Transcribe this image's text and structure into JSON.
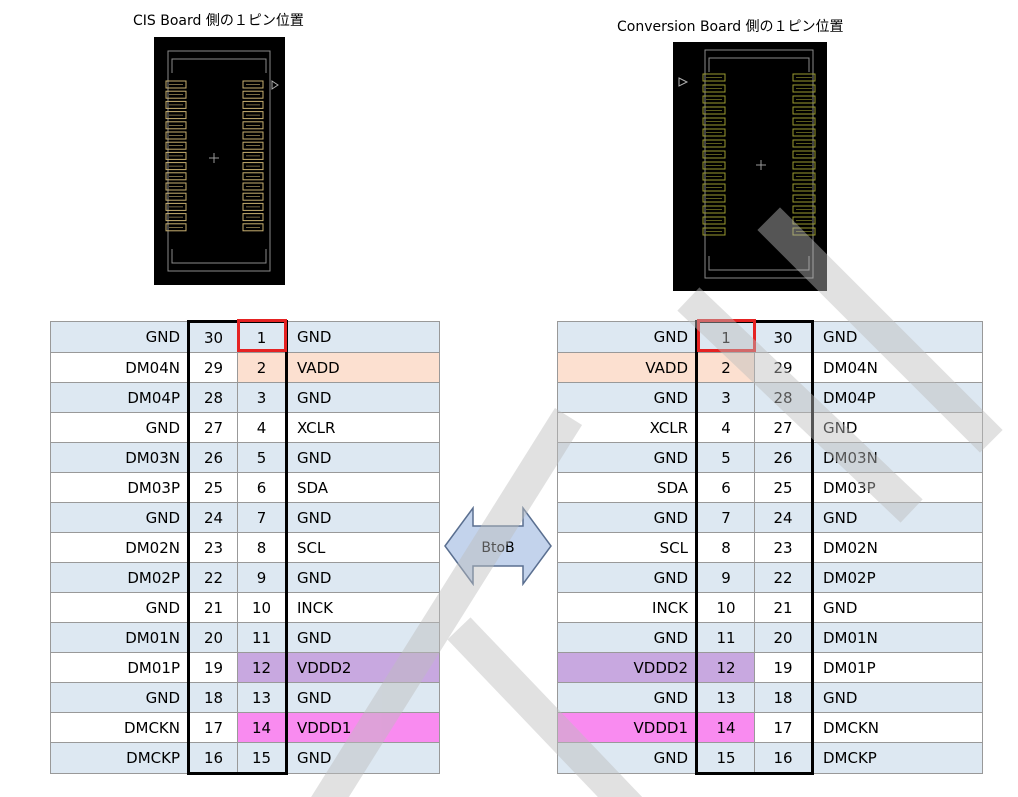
{
  "left": {
    "caption": "CIS  Board 側の１ピン位置",
    "rows": [
      {
        "name": "GND",
        "outer": "30",
        "inner": "1",
        "sig": "GND"
      },
      {
        "name": "DM04N",
        "outer": "29",
        "inner": "2",
        "sig": "VADD"
      },
      {
        "name": "DM04P",
        "outer": "28",
        "inner": "3",
        "sig": "GND"
      },
      {
        "name": "GND",
        "outer": "27",
        "inner": "4",
        "sig": "XCLR"
      },
      {
        "name": "DM03N",
        "outer": "26",
        "inner": "5",
        "sig": "GND"
      },
      {
        "name": "DM03P",
        "outer": "25",
        "inner": "6",
        "sig": "SDA"
      },
      {
        "name": "GND",
        "outer": "24",
        "inner": "7",
        "sig": "GND"
      },
      {
        "name": "DM02N",
        "outer": "23",
        "inner": "8",
        "sig": "SCL"
      },
      {
        "name": "DM02P",
        "outer": "22",
        "inner": "9",
        "sig": "GND"
      },
      {
        "name": "GND",
        "outer": "21",
        "inner": "10",
        "sig": "INCK"
      },
      {
        "name": "DM01N",
        "outer": "20",
        "inner": "11",
        "sig": "GND"
      },
      {
        "name": "DM01P",
        "outer": "19",
        "inner": "12",
        "sig": "VDDD2"
      },
      {
        "name": "GND",
        "outer": "18",
        "inner": "13",
        "sig": "GND"
      },
      {
        "name": "DMCKN",
        "outer": "17",
        "inner": "14",
        "sig": "VDDD1"
      },
      {
        "name": "DMCKP",
        "outer": "16",
        "inner": "15",
        "sig": "GND"
      }
    ]
  },
  "right": {
    "caption": "Conversion Board 側の１ピン位置",
    "rows": [
      {
        "sig": "GND",
        "inner": "1",
        "outer": "30",
        "name": "GND"
      },
      {
        "sig": "VADD",
        "inner": "2",
        "outer": "29",
        "name": "DM04N"
      },
      {
        "sig": "GND",
        "inner": "3",
        "outer": "28",
        "name": "DM04P"
      },
      {
        "sig": "XCLR",
        "inner": "4",
        "outer": "27",
        "name": "GND"
      },
      {
        "sig": "GND",
        "inner": "5",
        "outer": "26",
        "name": "DM03N"
      },
      {
        "sig": "SDA",
        "inner": "6",
        "outer": "25",
        "name": "DM03P"
      },
      {
        "sig": "GND",
        "inner": "7",
        "outer": "24",
        "name": "GND"
      },
      {
        "sig": "SCL",
        "inner": "8",
        "outer": "23",
        "name": "DM02N"
      },
      {
        "sig": "GND",
        "inner": "9",
        "outer": "22",
        "name": "DM02P"
      },
      {
        "sig": "INCK",
        "inner": "10",
        "outer": "21",
        "name": "GND"
      },
      {
        "sig": "GND",
        "inner": "11",
        "outer": "20",
        "name": "DM01N"
      },
      {
        "sig": "VDDD2",
        "inner": "12",
        "outer": "19",
        "name": "DM01P"
      },
      {
        "sig": "GND",
        "inner": "13",
        "outer": "18",
        "name": "GND"
      },
      {
        "sig": "VDDD1",
        "inner": "14",
        "outer": "17",
        "name": "DMCKN"
      },
      {
        "sig": "GND",
        "inner": "15",
        "outer": "16",
        "name": "DMCKP"
      }
    ]
  },
  "arrow": {
    "label": "BtoB",
    "color": "#c3d3ec"
  },
  "colors": {
    "row_even": "#dde8f2",
    "vadd": "#fce0d0",
    "vddd2": "#c8a8e0",
    "vddd1": "#f98bf0",
    "pin1_box": "#e52222",
    "left_pads": "#c8b070",
    "right_pads": "#9a9a30"
  }
}
